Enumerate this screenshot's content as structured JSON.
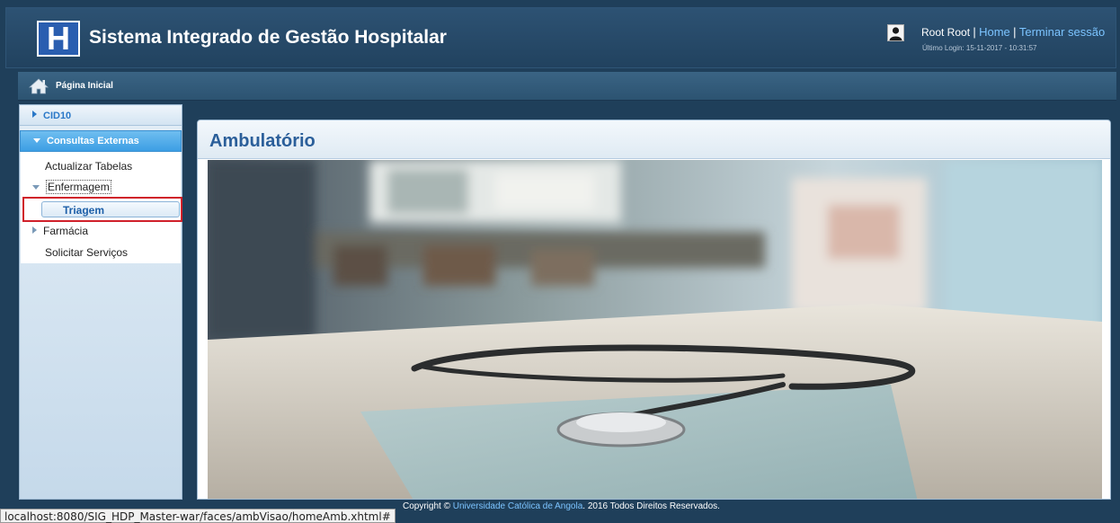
{
  "header": {
    "logo_letter": "H",
    "title": "Sistema Integrado de Gestão Hospitalar",
    "user_name": "Root Root",
    "home_link": "Home",
    "logout_link": "Terminar sessão",
    "separator": "|",
    "last_login": "Último Login: 15-11-2017 - 10:31:57"
  },
  "breadcrumb": {
    "label": "Página Inicial"
  },
  "sidebar": {
    "cid10": "CID10",
    "consultas": "Consultas Externas",
    "items": {
      "actualizar": "Actualizar Tabelas",
      "enfermagem": "Enfermagem",
      "triagem": "Triagem",
      "farmacia": "Farmácia",
      "solicitar": "Solicitar Serviços"
    }
  },
  "main": {
    "title": "Ambulatório"
  },
  "footer": {
    "copyright_prefix": "Copyright © ",
    "org": "Universidade Católica de Angola",
    "copyright_suffix": ". 2016 Todos Direitos Reservados."
  },
  "status_bar": {
    "url": "localhost:8080/SIG_HDP_Master-war/faces/ambVisao/homeAmb.xhtml#"
  },
  "colors": {
    "header_bg": "#21425f",
    "accent_blue": "#3c9ee4",
    "link": "#7cc4ff",
    "title_blue": "#2b5f9a",
    "selection_border": "#d0202a"
  }
}
